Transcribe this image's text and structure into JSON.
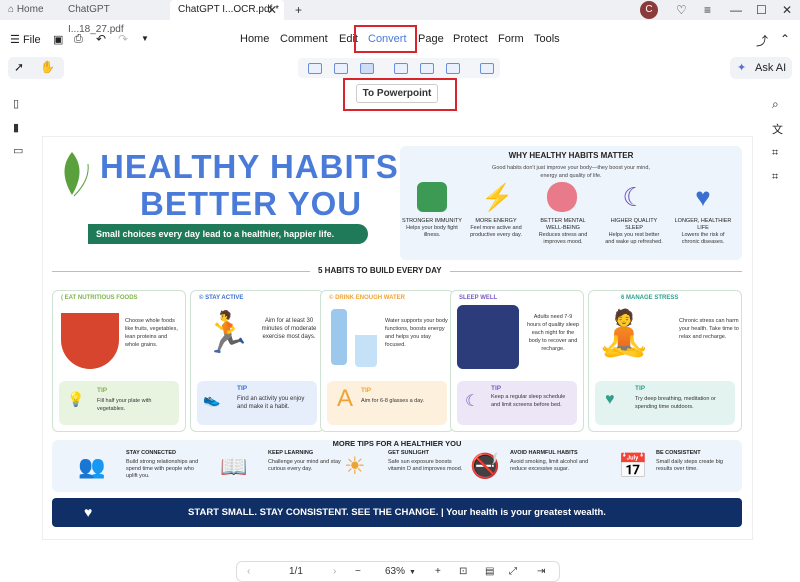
{
  "titlebar": {
    "home": "Home",
    "tabs": [
      "ChatGPT I...18_27.pdf",
      "ChatGPT I...OCR.pdf *"
    ],
    "new_tab": "+",
    "avatar": "C"
  },
  "menubar": {
    "file": "File",
    "items": [
      "Home",
      "Comment",
      "Edit",
      "Convert",
      "Page",
      "Protect",
      "Form",
      "Tools"
    ],
    "ask_ai": "Ask AI"
  },
  "tooltip": {
    "label": "To Powerpoint"
  },
  "document": {
    "hero": {
      "line1": "HEALTHY HABITS,",
      "line2": "BETTER YOU",
      "tagline": "Small choices every day lead to a healthier, happier life."
    },
    "why": {
      "title": "WHY HEALTHY HABITS MATTER",
      "subtitle": "Good habits don't just improve your body—they boost your mind, energy and quality of life.",
      "items": [
        {
          "title": "STRONGER IMMUNITY",
          "desc": "Helps your body fight illness."
        },
        {
          "title": "MORE ENERGY",
          "desc": "Feel more active and productive every day."
        },
        {
          "title": "BETTER MENTAL WELL-BEING",
          "desc": "Reduces stress and improves mood."
        },
        {
          "title": "HIGHER QUALITY SLEEP",
          "desc": "Helps you rest better and wake up refreshed."
        },
        {
          "title": "LONGER, HEALTHIER LIFE",
          "desc": "Lowers the risk of chronic diseases."
        }
      ]
    },
    "habits_title": "5 HABITS TO BUILD EVERY DAY",
    "habits": [
      {
        "title": "( EAT NUTRITIOUS FOODS",
        "text": "Choose whole foods like fruits, vegetables, lean proteins and whole grains.",
        "tip_label": "TIP",
        "tip": "Fill half your plate with vegetables.",
        "color": "#7fb34a"
      },
      {
        "title": "© STAY ACTIVE",
        "text": "Aim for at least 30 minutes of moderate exercise most days.",
        "tip_label": "TIP",
        "tip": "Find an activity you enjoy and make it a habit.",
        "color": "#3a6fd0"
      },
      {
        "title": "© DRINK ENOUGH WATER",
        "text": "Water supports your body functions, boosts energy and helps you stay focused.",
        "tip_label": "TIP",
        "tip": "Aim for 6-8 glasses a day.",
        "color": "#f0a334"
      },
      {
        "title": "SLEEP WELL",
        "text": "Adults need 7-9 hours of quality sleep each night for the body to recover and recharge.",
        "tip_label": "TIP",
        "tip": "Keep a regular sleep schedule and limit screens before bed.",
        "color": "#7a5cc8"
      },
      {
        "title": "6 MANAGE STRESS",
        "text": "Chronic stress can harm your health. Take time to relax and recharge.",
        "tip_label": "TIP",
        "tip": "Try deep breathing, meditation or spending time outdoors.",
        "color": "#2fa08c"
      }
    ],
    "more_title": "MORE TIPS FOR A HEALTHIER YOU",
    "more": [
      {
        "title": "STAY CONNECTED",
        "desc": "Build strong relationships and spend time with people who uplift you."
      },
      {
        "title": "KEEP LEARNING",
        "desc": "Challenge your mind and stay curious every day."
      },
      {
        "title": "GET SUNLIGHT",
        "desc": "Safe sun exposure boosts vitamin D and improves mood."
      },
      {
        "title": "AVOID HARMFUL HABITS",
        "desc": "Avoid smoking, limit alcohol and reduce excessive sugar."
      },
      {
        "title": "BE CONSISTENT",
        "desc": "Small daily steps create big results over time."
      }
    ],
    "banner": "START SMALL. STAY CONSISTENT. SEE THE CHANGE. | Your health is your greatest wealth."
  },
  "status": {
    "page": "1/1",
    "zoom": "63%"
  },
  "colors": {
    "accent": "#4a7bd8",
    "highlight": "#d9242c",
    "banner": "#0f2f66"
  }
}
